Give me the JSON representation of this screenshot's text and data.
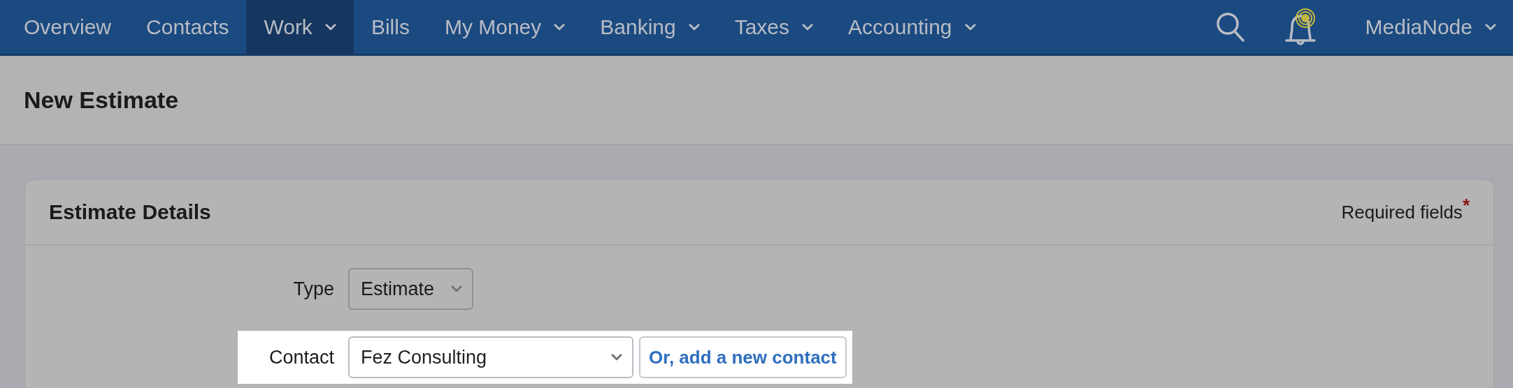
{
  "nav": {
    "items": [
      {
        "label": "Overview",
        "has_menu": false,
        "selected": false
      },
      {
        "label": "Contacts",
        "has_menu": false,
        "selected": false
      },
      {
        "label": "Work",
        "has_menu": true,
        "selected": true
      },
      {
        "label": "Bills",
        "has_menu": false,
        "selected": false
      },
      {
        "label": "My Money",
        "has_menu": true,
        "selected": false
      },
      {
        "label": "Banking",
        "has_menu": true,
        "selected": false
      },
      {
        "label": "Taxes",
        "has_menu": true,
        "selected": false
      },
      {
        "label": "Accounting",
        "has_menu": true,
        "selected": false
      }
    ],
    "notifications": {
      "unread": true
    },
    "account": {
      "label": "MediaNode",
      "has_menu": true
    }
  },
  "page": {
    "title": "New Estimate"
  },
  "card": {
    "title": "Estimate Details",
    "required_note": "Required fields",
    "required_mark": "*",
    "fields": [
      {
        "label": "Type",
        "value": "Estimate",
        "highlighted": false
      },
      {
        "label": "Contact",
        "value": "Fez Consulting",
        "highlighted": true,
        "action": "Or, add a new contact"
      }
    ]
  }
}
